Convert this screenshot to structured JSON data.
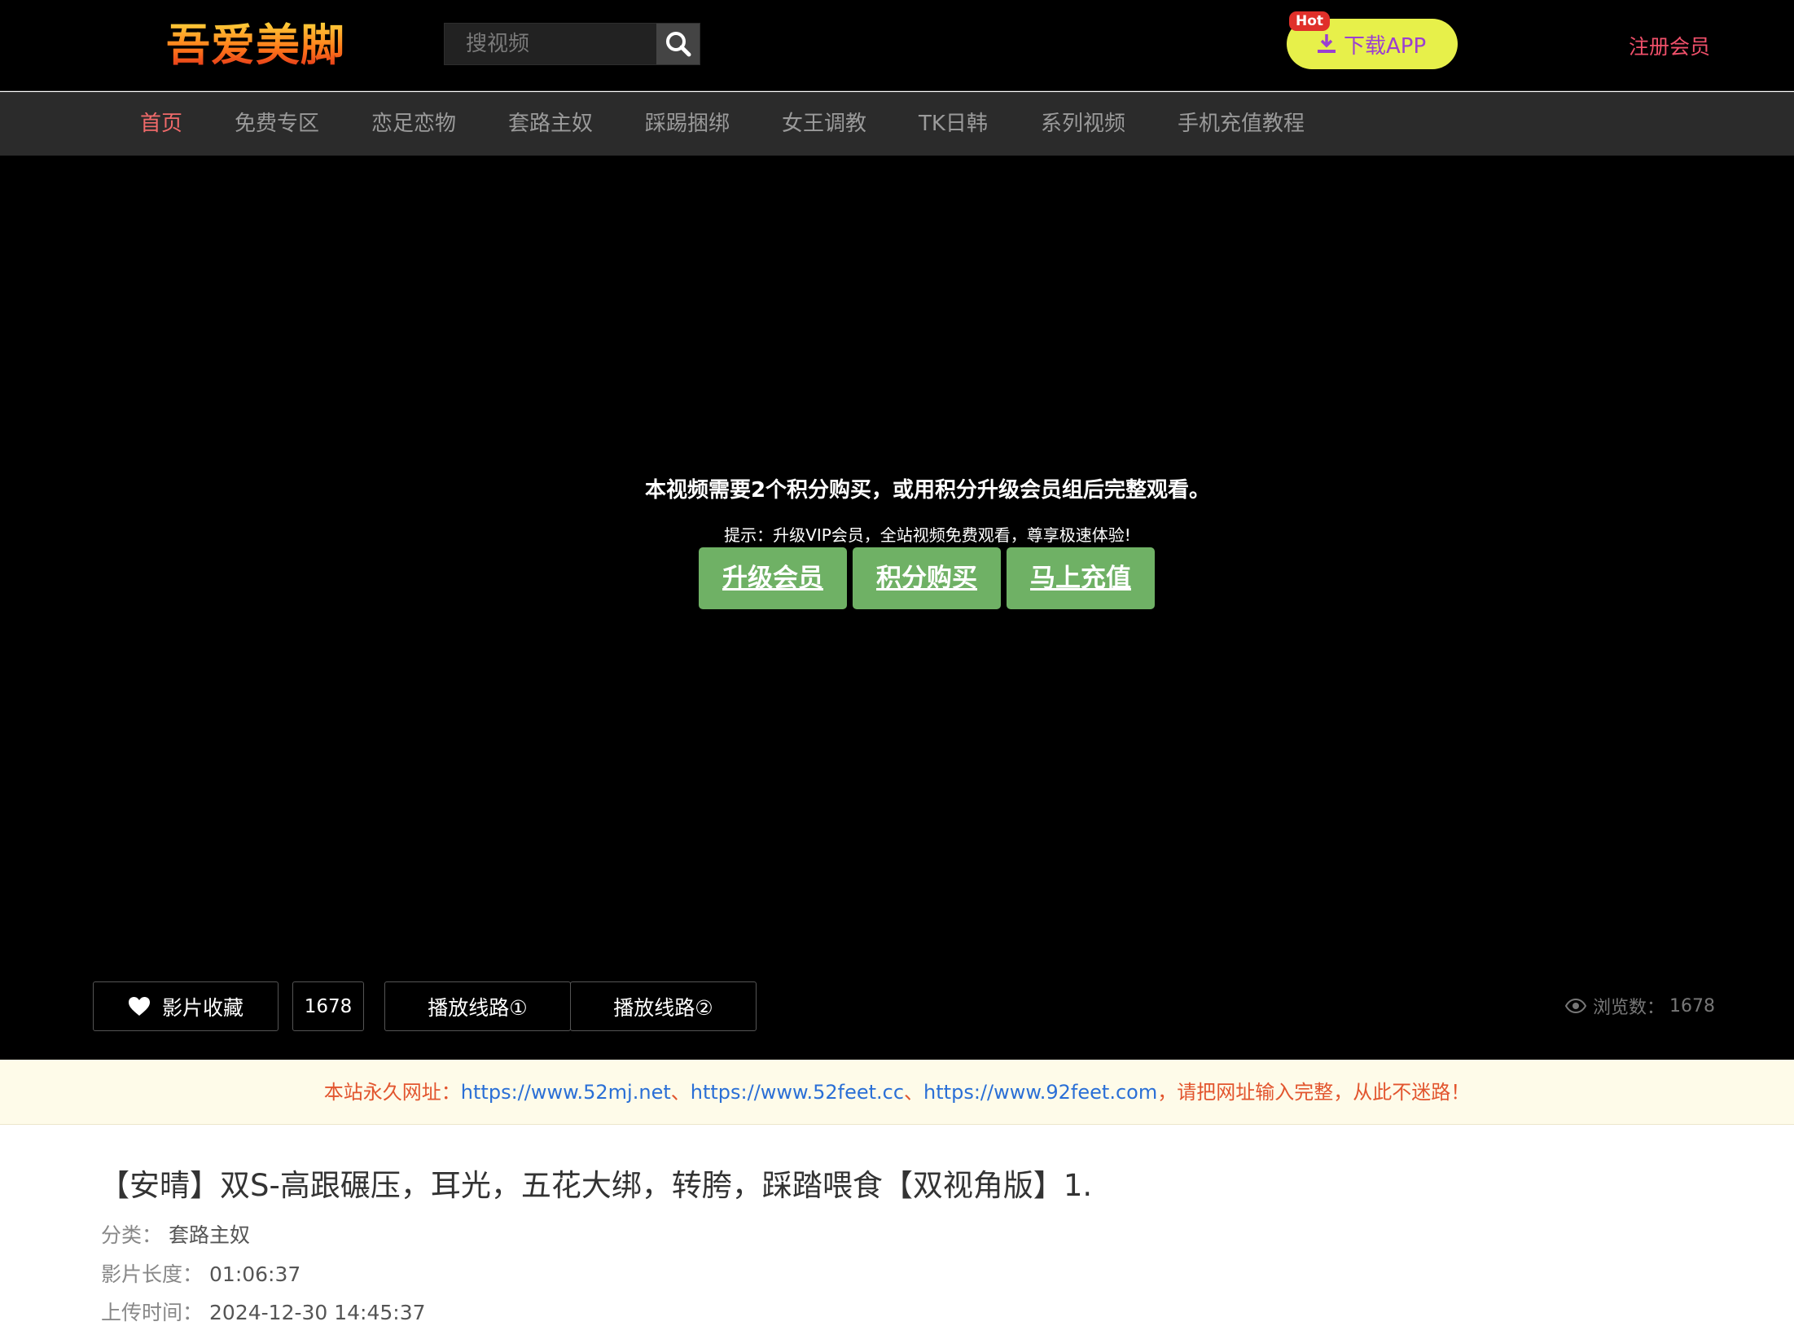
{
  "header": {
    "logo_text": "吾爱美脚",
    "search_placeholder": "搜视频",
    "app_hot_badge": "Hot",
    "app_button_label": "下载APP",
    "register_label": "注册会员"
  },
  "nav": {
    "items": [
      {
        "label": "首页",
        "active": true
      },
      {
        "label": "免费专区"
      },
      {
        "label": "恋足恋物"
      },
      {
        "label": "套路主奴"
      },
      {
        "label": "踩踢捆绑"
      },
      {
        "label": "女王调教"
      },
      {
        "label": "TK日韩"
      },
      {
        "label": "系列视频"
      },
      {
        "label": "手机充值教程"
      }
    ]
  },
  "player": {
    "message": "本视频需要2个积分购买，或用积分升级会员组后完整观看。",
    "tip": "提示：升级VIP会员，全站视频免费观看，尊享极速体验!",
    "buttons": [
      "升级会员",
      "积分购买",
      "马上充值"
    ]
  },
  "controls": {
    "favorite_label": "影片收藏",
    "favorite_count": "1678",
    "route1": "播放线路①",
    "route2": "播放线路②",
    "views_label": "浏览数：",
    "views_count": "1678"
  },
  "notice": {
    "prefix": "本站永久网址：",
    "url1": "https://www.52mj.net",
    "sep": "、",
    "url2": "https://www.52feet.cc",
    "url3": "https://www.92feet.com",
    "suffix": "，请把网址输入完整，从此不迷路！"
  },
  "video": {
    "title": "【安晴】双S-高跟碾压，耳光，五花大绑，转胯，踩踏喂食【双视角版】1.",
    "category_label": "分类：",
    "category": "套路主奴",
    "length_label": "影片长度：",
    "length": "01:06:37",
    "upload_label": "上传时间：",
    "upload": "2024-12-30 14:45:37"
  },
  "colors": {
    "accent_green": "#6fb165",
    "nav_active": "#f06a6a",
    "app_button": "#e7f04a"
  }
}
